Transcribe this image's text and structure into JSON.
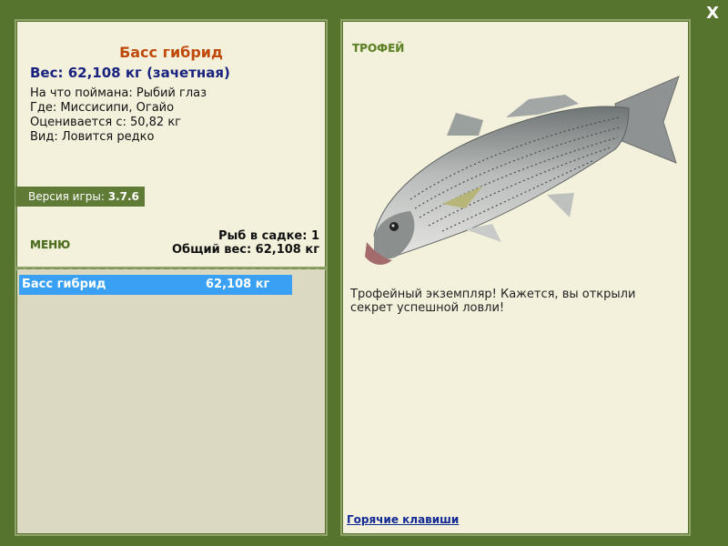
{
  "window": {
    "close_label": "X"
  },
  "fish": {
    "name": "Басс гибрид",
    "weight_line": "Вес: 62,108 кг (зачетная)",
    "caught_on": "На что поймана: Рыбий глаз",
    "where": "Где: Миссисипи, Огайо",
    "valued_from": "Оценивается с: 50,82 кг",
    "kind": "Вид: Ловится редко"
  },
  "version": {
    "label": "Версия игры:",
    "value": "3.7.6"
  },
  "menu": {
    "label": "МЕНЮ"
  },
  "keepnet": {
    "count_line": "Рыб в садке: 1",
    "total_line": "Общий вес: 62,108 кг"
  },
  "catch_list": [
    {
      "name": "Басс гибрид",
      "weight": "62,108 кг"
    }
  ],
  "trophy": {
    "title": "ТРОФЕЙ",
    "text": "Трофейный экземпляр! Кажется, вы открыли секрет успешной ловли!",
    "hotkeys_label": "Горячие клавиши"
  },
  "colors": {
    "background": "#56742e",
    "panel": "#f3f1dc",
    "accent_name": "#c04a0b",
    "weight": "#19227f",
    "selection": "#3aa0f4"
  },
  "icons": {
    "close": "close-icon",
    "fish": "fish-illustration"
  }
}
